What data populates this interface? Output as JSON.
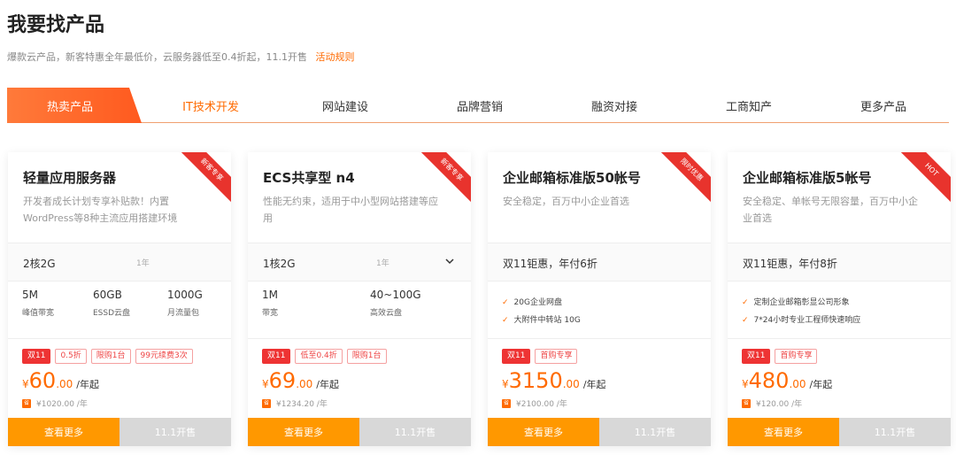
{
  "header": {
    "title": "我要找产品",
    "subtitle": "爆款云产品，新客特惠全年最低价，云服务器低至0.4折起，11.1开售",
    "rules_link": "活动规则"
  },
  "tabs": [
    "热卖产品",
    "IT技术开发",
    "网站建设",
    "品牌营销",
    "融资对接",
    "工商知产",
    "更多产品"
  ],
  "colors": {
    "accent": "#ff6a00",
    "tag_red": "#e33333",
    "button_orange": "#ff9800"
  },
  "cards": [
    {
      "name": "轻量应用服务器",
      "desc": "开发者成长计划专享补贴款！内置WordPress等8种主流应用搭建环境",
      "corner": "新客专享",
      "spec": "2核2G",
      "term": "1年",
      "stats": [
        {
          "value": "5M",
          "label": "峰值带宽"
        },
        {
          "value": "60GB",
          "label": "ESSD云盘"
        },
        {
          "value": "1000G",
          "label": "月流量包"
        }
      ],
      "tags": [
        "双11",
        "0.5折",
        "限购1台",
        "99元续费3次"
      ],
      "price_cur": "¥",
      "price_int": "60",
      "price_dec": ".00",
      "price_unit": "/年起",
      "orig_badge": "省",
      "orig": "¥1020.00 /年",
      "btn_more": "查看更多",
      "btn_sale": "11.1开售"
    },
    {
      "name": "ECS共享型 n4",
      "desc": "性能无约束，适用于中小型网站搭建等应用",
      "corner": "新客专享",
      "spec": "1核2G",
      "term": "1年",
      "stats": [
        {
          "value": "1M",
          "label": "带宽"
        },
        {
          "value": "40~100G",
          "label": "高效云盘"
        }
      ],
      "tags": [
        "双11",
        "低至0.4折",
        "限购1台"
      ],
      "price_cur": "¥",
      "price_int": "69",
      "price_dec": ".00",
      "price_unit": "/年起",
      "orig_badge": "省",
      "orig": "¥1234.20 /年",
      "btn_more": "查看更多",
      "btn_sale": "11.1开售"
    },
    {
      "name": "企业邮箱标准版50帐号",
      "desc": "安全稳定，百万中小企业首选",
      "corner": "限时优惠",
      "spec": "双11钜惠，年付6折",
      "features": [
        "20G企业网盘",
        "大附件中转站 10G"
      ],
      "tags": [
        "双11",
        "首购专享"
      ],
      "price_cur": "¥",
      "price_int": "3150",
      "price_dec": ".00",
      "price_unit": "/年起",
      "orig_badge": "省",
      "orig": "¥2100.00 /年",
      "btn_more": "查看更多",
      "btn_sale": "11.1开售"
    },
    {
      "name": "企业邮箱标准版5帐号",
      "desc": "安全稳定、单帐号无限容量，百万中小企业首选",
      "corner": "HOT",
      "spec": "双11钜惠，年付8折",
      "features": [
        "定制企业邮箱彰显公司形象",
        "7*24小时专业工程师快速响应"
      ],
      "tags": [
        "双11",
        "首购专享"
      ],
      "price_cur": "¥",
      "price_int": "480",
      "price_dec": ".00",
      "price_unit": "/年起",
      "orig_badge": "省",
      "orig": "¥120.00 /年",
      "btn_more": "查看更多",
      "btn_sale": "11.1开售"
    }
  ]
}
